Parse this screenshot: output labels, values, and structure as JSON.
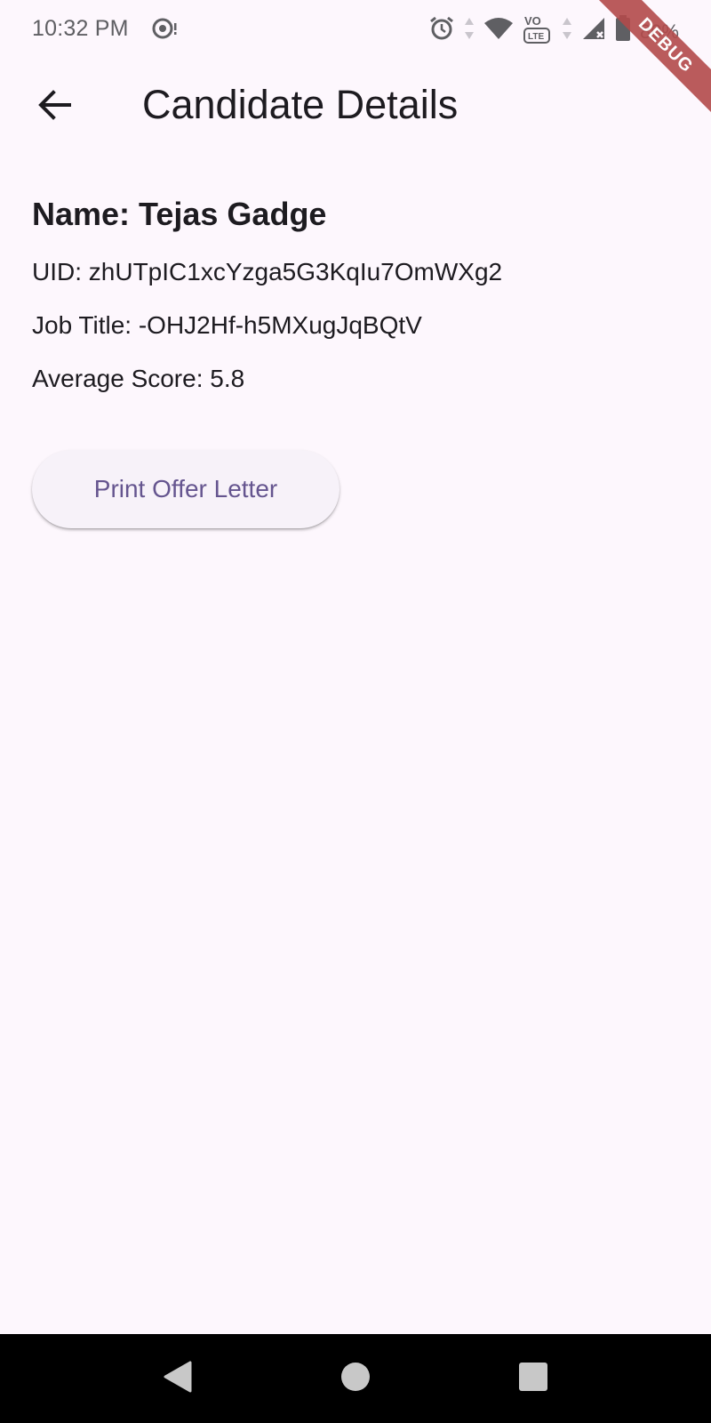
{
  "status_bar": {
    "time": "10:32 PM",
    "battery_text": "80%",
    "icons": [
      "data-saver-icon",
      "alarm-icon",
      "wifi-icon",
      "volte-icon",
      "signal-icon",
      "battery-icon"
    ]
  },
  "debug_banner": {
    "label": "DEBUG"
  },
  "app_bar": {
    "title": "Candidate Details",
    "back_icon": "arrow-back-icon"
  },
  "candidate": {
    "name": "Name: Tejas Gadge",
    "uid": "UID: zhUTpIC1xcYzga5G3KqIu7OmWXg2",
    "job_title": "Job Title: -OHJ2Hf-h5MXugJqBQtV",
    "average_score": "Average Score: 5.8"
  },
  "actions": {
    "print_offer_letter": "Print Offer Letter"
  },
  "colors": {
    "background": "#fdf7fd",
    "accent": "#65558f",
    "debug_ribbon": "#b34b4b"
  }
}
